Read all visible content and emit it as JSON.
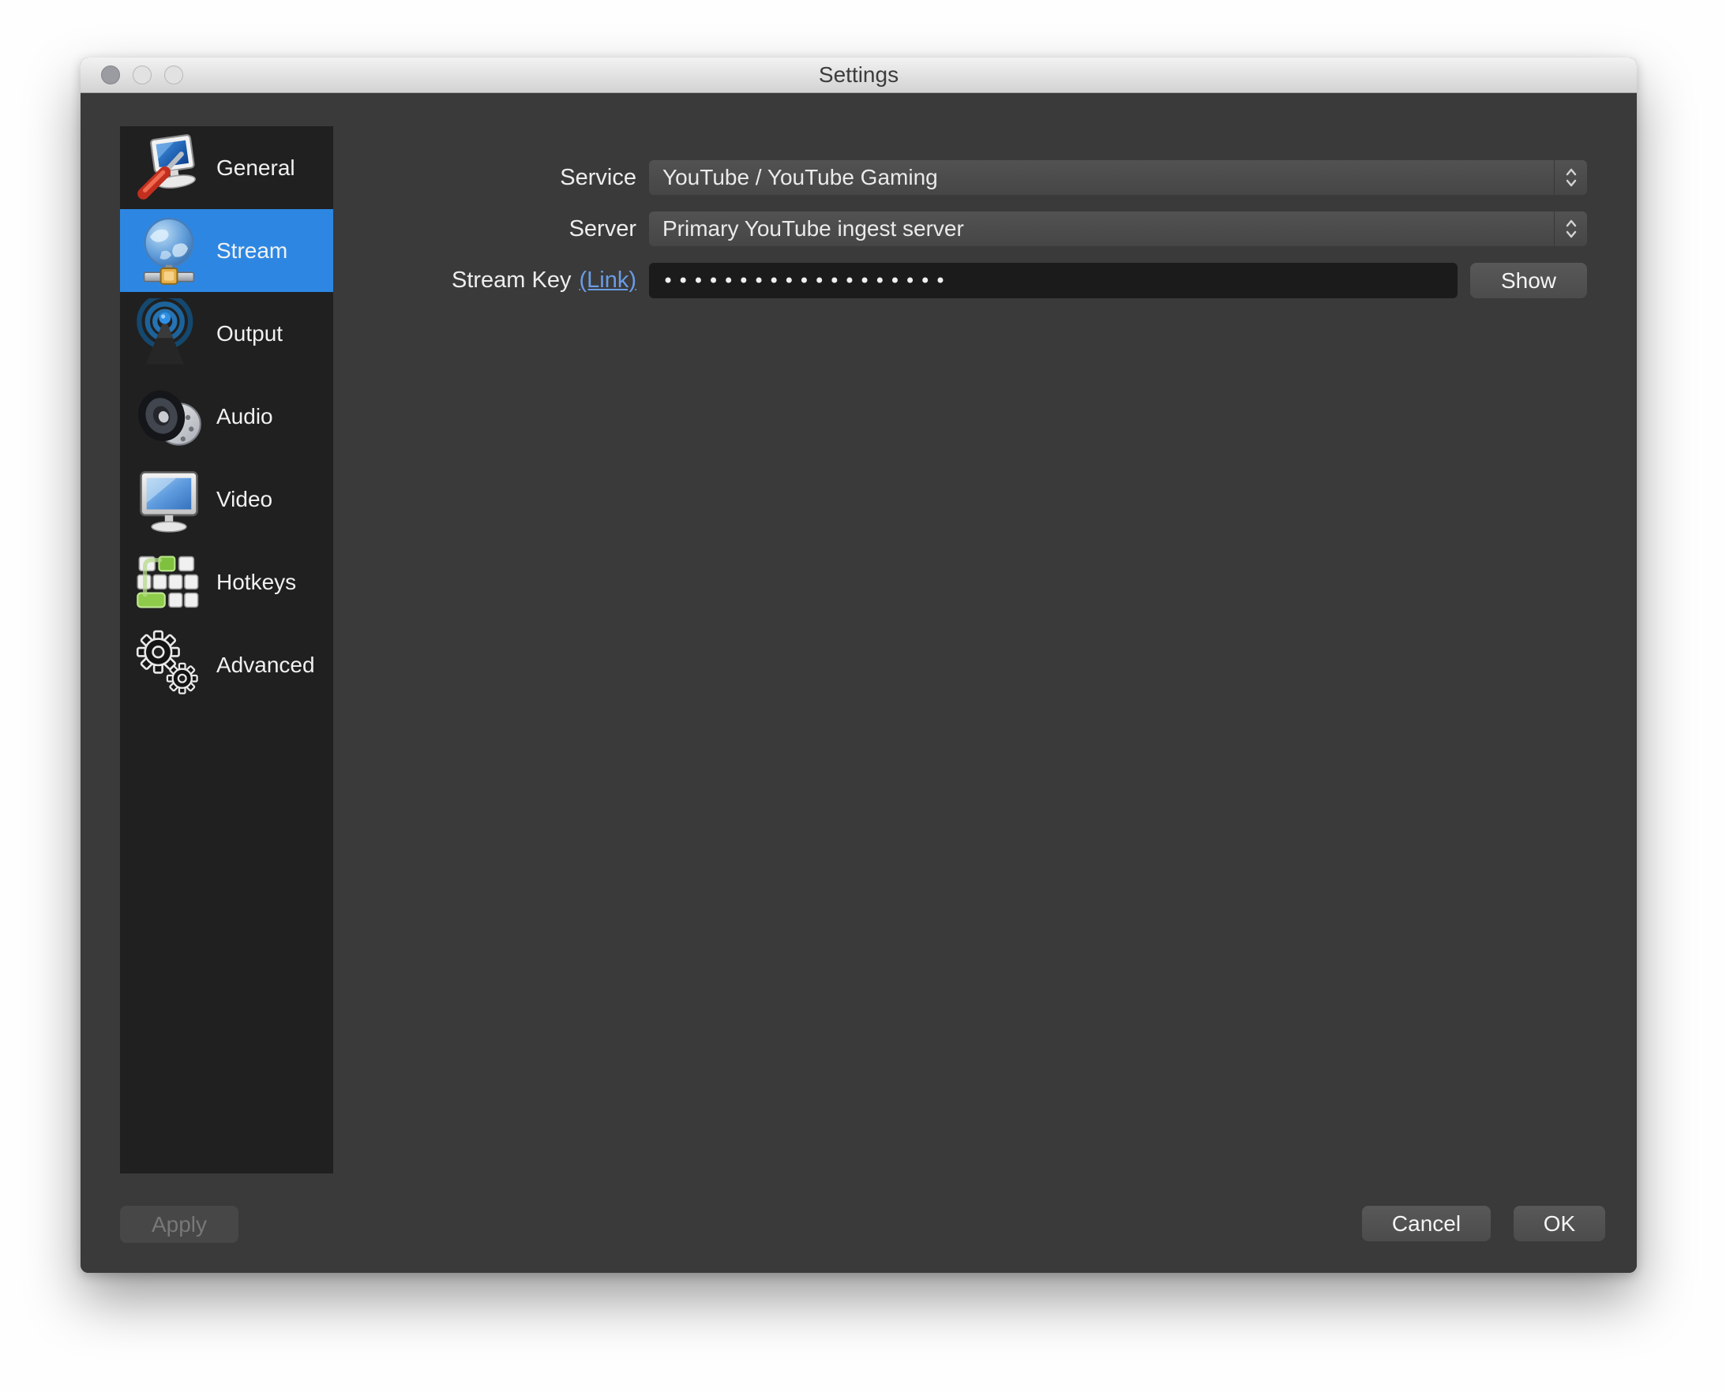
{
  "window": {
    "title": "Settings"
  },
  "colors": {
    "accent_blue": "#2d87e2",
    "link_blue": "#6a9ce6",
    "content_bg": "#3a3a3a",
    "sidebar_bg": "#202020",
    "field_bg": "#1b1b1b"
  },
  "titlebar": {
    "close": "close-traffic-light",
    "minimize": "minimize-traffic-light",
    "maximize": "maximize-traffic-light"
  },
  "sidebar": {
    "items": [
      {
        "label": "General",
        "icon": "general-monitor-screwdriver-icon",
        "selected": false
      },
      {
        "label": "Stream",
        "icon": "stream-globe-network-icon",
        "selected": true
      },
      {
        "label": "Output",
        "icon": "output-broadcast-icon",
        "selected": false
      },
      {
        "label": "Audio",
        "icon": "audio-speaker-icon",
        "selected": false
      },
      {
        "label": "Video",
        "icon": "video-monitor-icon",
        "selected": false
      },
      {
        "label": "Hotkeys",
        "icon": "hotkeys-keyboard-icon",
        "selected": false
      },
      {
        "label": "Advanced",
        "icon": "advanced-gears-icon",
        "selected": false
      }
    ]
  },
  "form": {
    "service": {
      "label": "Service",
      "value": "YouTube / YouTube Gaming"
    },
    "server": {
      "label": "Server",
      "value": "Primary YouTube ingest server"
    },
    "stream_key": {
      "label": "Stream Key",
      "link_label": "(Link)",
      "masked_value": "•••••••••••••••••••",
      "show_button": "Show"
    }
  },
  "footer": {
    "apply": "Apply",
    "apply_enabled": false,
    "cancel": "Cancel",
    "ok": "OK"
  }
}
